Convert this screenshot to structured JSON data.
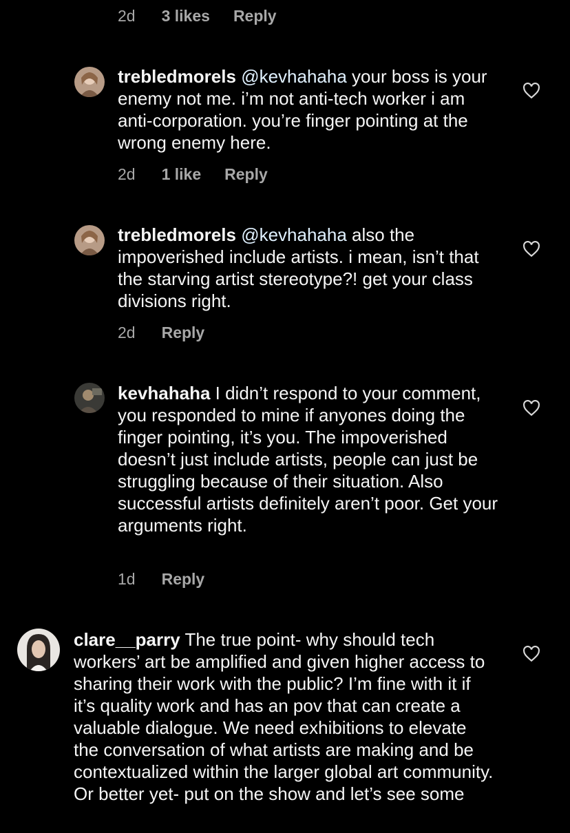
{
  "top_meta": {
    "time": "2d",
    "likes": "3 likes",
    "reply": "Reply"
  },
  "comments": [
    {
      "username": "trebledmorels",
      "mention": "@kevhahaha",
      "text": " your boss is your enemy not me. i’m not anti-tech worker i am anti-corporation. you’re finger pointing at the wrong enemy here.",
      "time": "2d",
      "likes": "1 like",
      "reply": "Reply"
    },
    {
      "username": "trebledmorels",
      "mention": "@kevhahaha",
      "text": " also the impoverished include artists. i mean, isn’t that the starving artist stereotype?! get your class divisions right.",
      "time": "2d",
      "reply": "Reply"
    },
    {
      "username": "kevhahaha",
      "text": " I didn’t respond to your comment, you responded to mine if anyones doing the finger pointing, it’s you. The impoverished doesn’t just include artists, people can just be struggling because of their situation. Also successful artists definitely aren’t poor. Get your arguments right.",
      "time": "1d",
      "reply": "Reply"
    },
    {
      "username": "clare__parry",
      "text": " The true point- why should tech workers’ art be amplified and given higher access to sharing their work with the public? I’m fine with it if it’s quality work and has an pov that can create a valuable dialogue.  We need exhibitions to elevate the conversation of what artists are making and be contextualized within the larger global art community.  Or better yet- put on the show and let’s see some"
    }
  ],
  "icons": {
    "like": "heart-outline-icon",
    "avatar": "profile-photo"
  },
  "colors": {
    "background": "#000000",
    "text": "#f5f5f5",
    "secondary": "#a8a8a8",
    "mention": "#e0f1ff"
  }
}
